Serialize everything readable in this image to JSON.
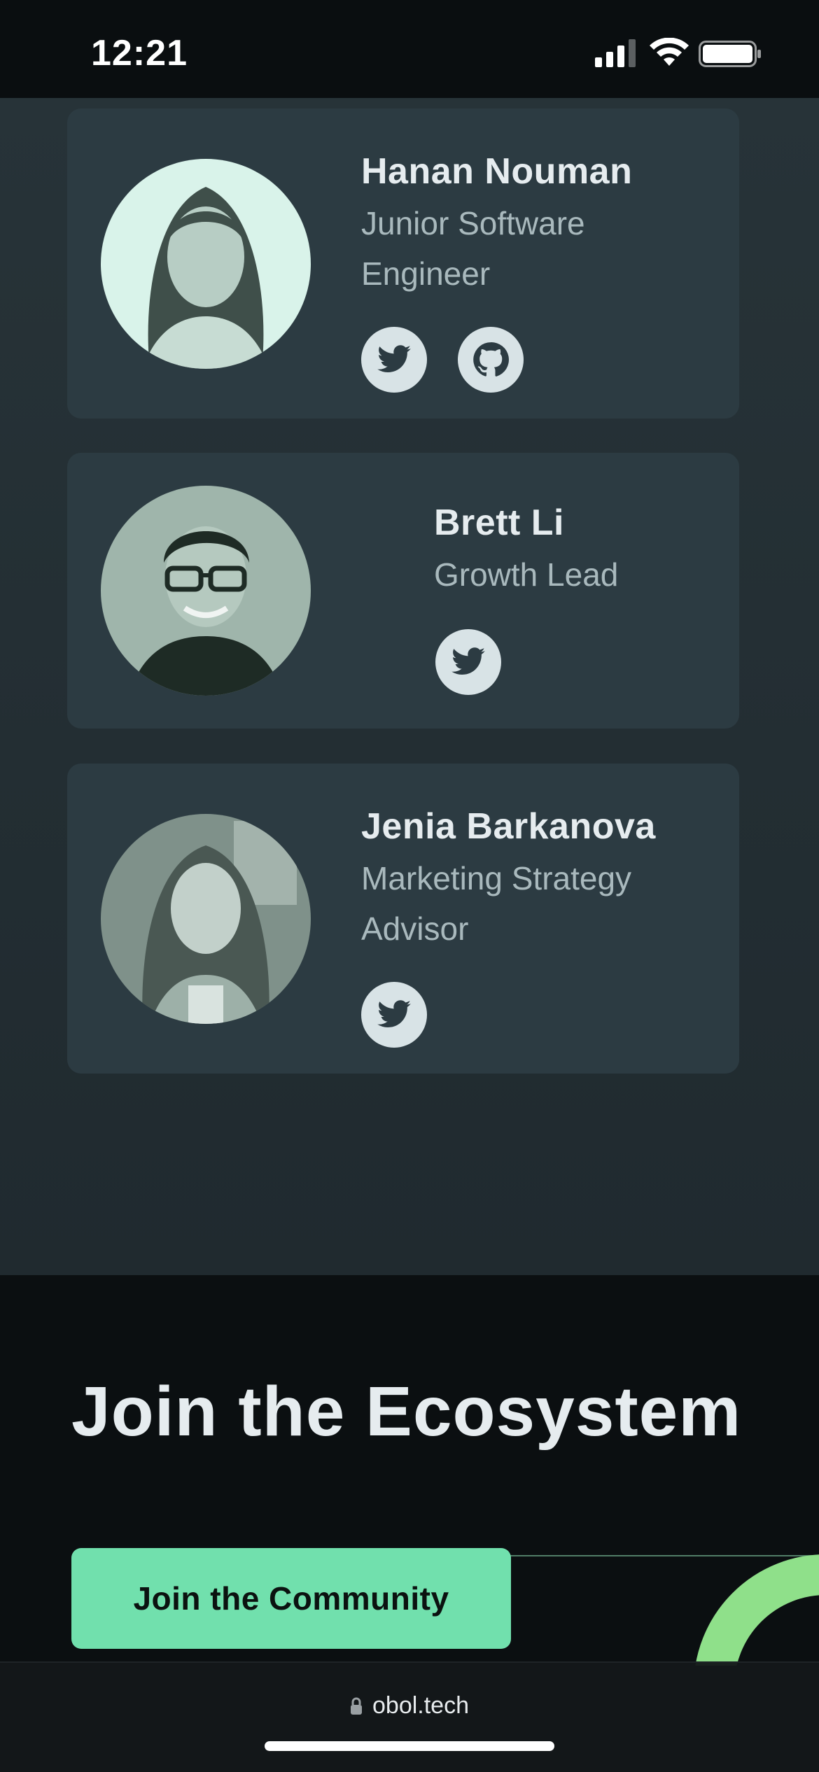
{
  "status_bar": {
    "time": "12:21"
  },
  "team": [
    {
      "name": "Hanan Nouman",
      "role_line1": "Junior Software",
      "role_line2": "Engineer",
      "socials": [
        "twitter-icon",
        "github-icon"
      ]
    },
    {
      "name": "Brett Li",
      "role_line1": "Growth Lead",
      "role_line2": "",
      "socials": [
        "twitter-icon"
      ]
    },
    {
      "name": "Jenia Barkanova",
      "role_line1": "Marketing Strategy",
      "role_line2": "Advisor",
      "socials": [
        "twitter-icon"
      ]
    }
  ],
  "join": {
    "title": "Join the Ecosystem",
    "button_label": "Join the Community"
  },
  "browser": {
    "url": "obol.tech"
  },
  "colors": {
    "accent": "#71e0ad",
    "card_bg": "#2c3b42",
    "section_bg": "#273338",
    "page_bg": "#0b0f11"
  }
}
